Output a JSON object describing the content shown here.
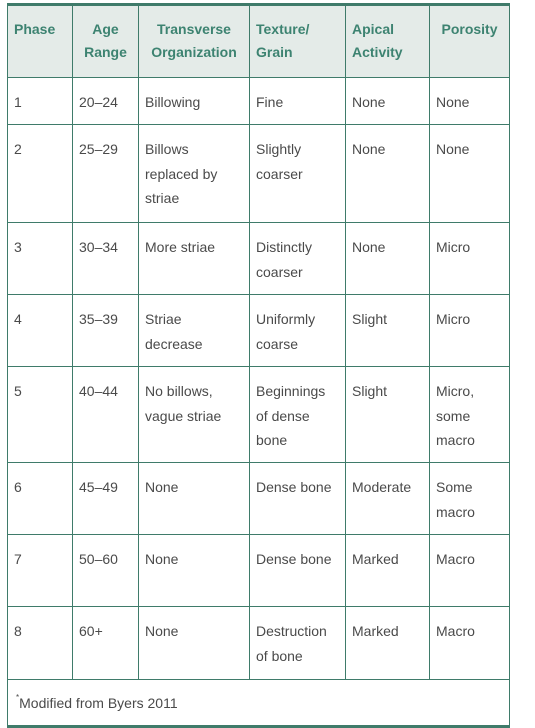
{
  "table": {
    "headers": [
      [
        "Phase"
      ],
      [
        "Age",
        "Range"
      ],
      [
        "Transverse",
        "Organization"
      ],
      [
        "Texture/",
        "Grain"
      ],
      [
        "Apical",
        "Activity"
      ],
      [
        "Porosity"
      ]
    ],
    "rows": [
      {
        "phase": "1",
        "age": "20–24",
        "transverse": "Billowing",
        "texture": "Fine",
        "apical": "None",
        "porosity": "None"
      },
      {
        "phase": "2",
        "age": "25–29",
        "transverse": "Billows replaced by striae",
        "texture": "Slightly coarser",
        "apical": "None",
        "porosity": "None"
      },
      {
        "phase": "3",
        "age": "30–34",
        "transverse": "More striae",
        "texture": "Distinctly coarser",
        "apical": "None",
        "porosity": "Micro"
      },
      {
        "phase": "4",
        "age": "35–39",
        "transverse": "Striae decrease",
        "texture": "Uniformly coarse",
        "apical": "Slight",
        "porosity": "Micro"
      },
      {
        "phase": "5",
        "age": "40–44",
        "transverse": "No billows, vague striae",
        "texture": "Beginnings of dense bone",
        "apical": "Slight",
        "porosity": "Micro, some macro"
      },
      {
        "phase": "6",
        "age": "45–49",
        "transverse": "None",
        "texture": "Dense bone",
        "apical": "Moderate",
        "porosity": "Some macro"
      },
      {
        "phase": "7",
        "age": "50–60",
        "transverse": "None",
        "texture": "Dense bone",
        "apical": "Marked",
        "porosity": "Macro"
      },
      {
        "phase": "8",
        "age": "60+",
        "transverse": "None",
        "texture": "Destruction of bone",
        "apical": "Marked",
        "porosity": "Macro"
      }
    ],
    "footnote": {
      "marker": "*",
      "text": "Modified from Byers 2011"
    }
  },
  "colors": {
    "border": "#3f7b6a",
    "header_bg": "#e4ebe8",
    "header_text": "#3d8371",
    "body_text": "#4a4a4a"
  }
}
